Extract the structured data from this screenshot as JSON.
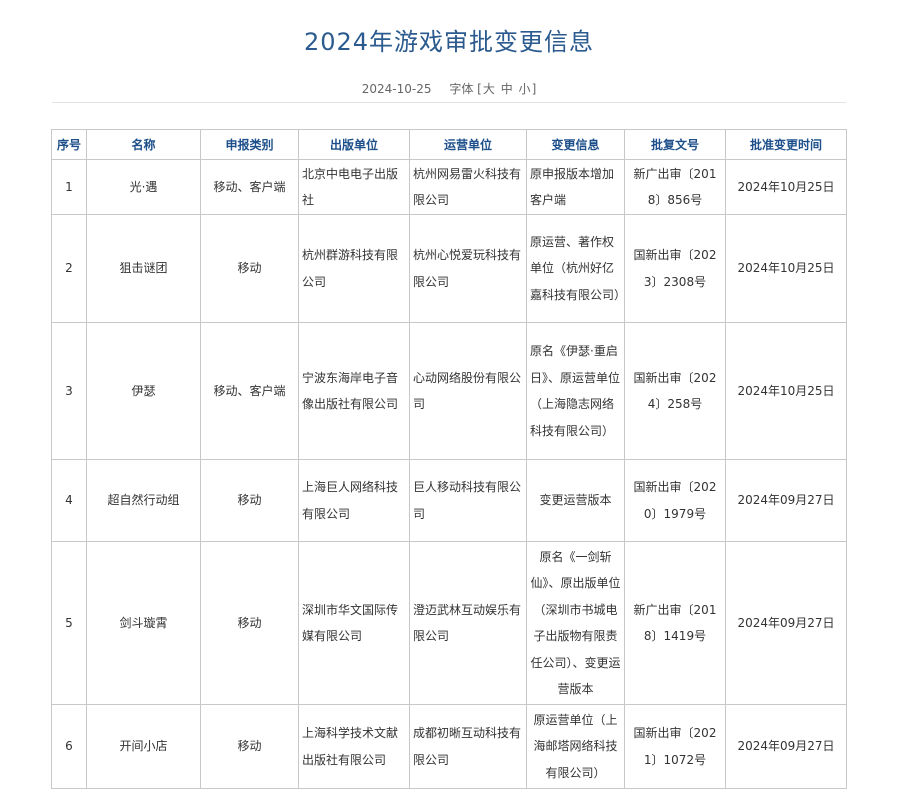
{
  "page": {
    "title": "2024年游戏审批变更信息",
    "date": "2024-10-25",
    "font_size_label": "字体",
    "font_size_open": "[",
    "font_size_close": "]",
    "font_sizes": [
      "大",
      "中",
      "小"
    ]
  },
  "table": {
    "headers": [
      "序号",
      "名称",
      "申报类别",
      "出版单位",
      "运营单位",
      "变更信息",
      "批复文号",
      "批准变更时间"
    ],
    "rows": [
      {
        "no": "1",
        "name": "光·遇",
        "category": "移动、客户端",
        "publisher": "北京中电电子出版社",
        "operator": "杭州网易雷火科技有限公司",
        "change": "原申报版本增加客户端",
        "approval": "新广出审〔2018〕856号",
        "date": "2024年10月25日"
      },
      {
        "no": "2",
        "name": "狙击谜团",
        "category": "移动",
        "publisher": "杭州群游科技有限公司",
        "operator": "杭州心悦爱玩科技有限公司",
        "change": "原运营、著作权单位（杭州好亿嘉科技有限公司）",
        "approval": "国新出审〔2023〕2308号",
        "date": "2024年10月25日"
      },
      {
        "no": "3",
        "name": "伊瑟",
        "category": "移动、客户端",
        "publisher": "宁波东海岸电子音像出版社有限公司",
        "operator": "心动网络股份有限公司",
        "change": "原名《伊瑟·重启日》、原运营单位（上海隐志网络科技有限公司）",
        "approval": "国新出审〔2024〕258号",
        "date": "2024年10月25日"
      },
      {
        "no": "4",
        "name": "超自然行动组",
        "category": "移动",
        "publisher": "上海巨人网络科技有限公司",
        "operator": "巨人移动科技有限公司",
        "change": "变更运营版本",
        "approval": "国新出审〔2020〕1979号",
        "date": "2024年09月27日"
      },
      {
        "no": "5",
        "name": "剑斗璇霄",
        "category": "移动",
        "publisher": "深圳市华文国际传媒有限公司",
        "operator": "澄迈武林互动娱乐有限公司",
        "change": "原名《一剑斩仙》、原出版单位（深圳市书城电子出版物有限责任公司）、变更运营版本",
        "approval": "新广出审〔2018〕1419号",
        "date": "2024年09月27日"
      },
      {
        "no": "6",
        "name": "开间小店",
        "category": "移动",
        "publisher": "上海科学技术文献出版社有限公司",
        "operator": "成都初晰互动科技有限公司",
        "change": "原运营单位（上海邮塔网络科技有限公司）",
        "approval": "国新出审〔2021〕1072号",
        "date": "2024年09月27日"
      }
    ]
  },
  "colors": {
    "title": "#2b5a8e",
    "header_text": "#1d4f8a",
    "border": "#c8c8c8",
    "body_text": "#333333"
  }
}
